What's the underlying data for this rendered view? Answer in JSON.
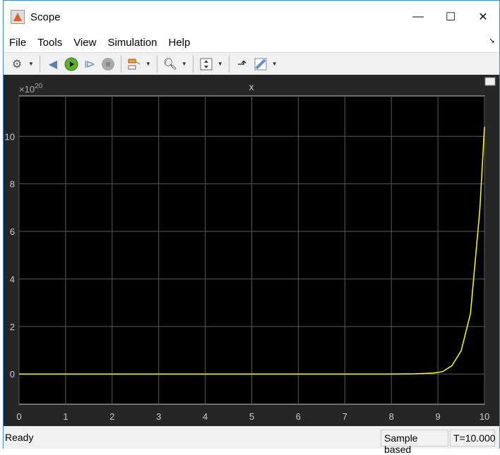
{
  "window": {
    "title": "Scope",
    "controls": {
      "minimize": "—",
      "maximize": "☐",
      "close": "✕"
    }
  },
  "menu": [
    "File",
    "Tools",
    "View",
    "Simulation",
    "Help"
  ],
  "toolbar": [
    "settings-icon",
    "step-back-icon",
    "run-icon",
    "step-forward-icon",
    "stop-icon",
    "signal-select-icon",
    "zoom-in-icon",
    "autoscale-icon",
    "triggers-icon",
    "measurements-icon"
  ],
  "status": {
    "ready": "Ready",
    "mode": "Sample based",
    "time": "T=10.000"
  },
  "chart_data": {
    "type": "line",
    "title": "x",
    "exponent_label": "×10",
    "exponent": "20",
    "xlim": [
      0,
      10
    ],
    "ylim": [
      -1.27,
      11.7
    ],
    "xticks": [
      0,
      1,
      2,
      3,
      4,
      5,
      6,
      7,
      8,
      9,
      10
    ],
    "yticks": [
      0,
      2,
      4,
      6,
      8,
      10
    ],
    "grid": true,
    "colors": {
      "line": "#ffff00",
      "background": "#000000",
      "grid": "#5a5a5a",
      "axes": "#c8c8c8",
      "panel": "#262626"
    },
    "series": [
      {
        "x": [
          0,
          1,
          2,
          3,
          4,
          5,
          6,
          7,
          8,
          8.5,
          8.9,
          9.1,
          9.3,
          9.5,
          9.7,
          9.9,
          10
        ],
        "y": [
          0,
          0,
          0,
          0,
          0,
          0,
          0,
          0,
          0,
          0.01,
          0.04,
          0.1,
          0.35,
          0.98,
          2.55,
          6.9,
          10.4
        ]
      }
    ]
  }
}
